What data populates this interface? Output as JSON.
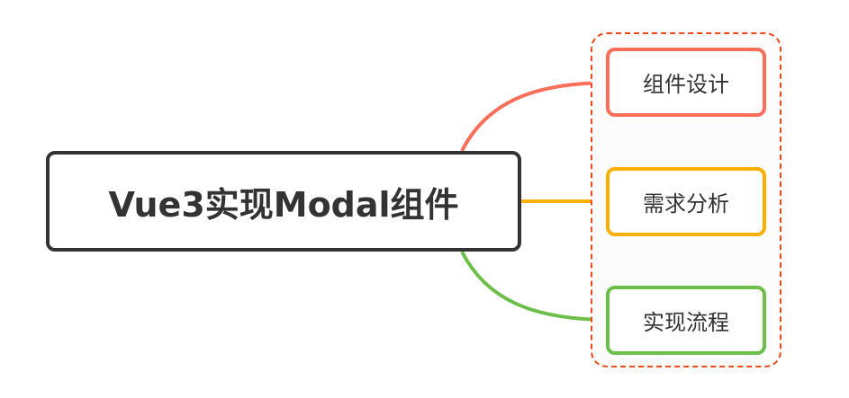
{
  "root": {
    "label": "Vue3实现Modal组件",
    "border_color": "#333333"
  },
  "children": [
    {
      "label": "组件设计",
      "color": "#fa6e5a"
    },
    {
      "label": "需求分析",
      "color": "#fbb000"
    },
    {
      "label": "实现流程",
      "color": "#6cc04a"
    }
  ],
  "group": {
    "border_color": "#f04a1a",
    "style": "dashed"
  }
}
